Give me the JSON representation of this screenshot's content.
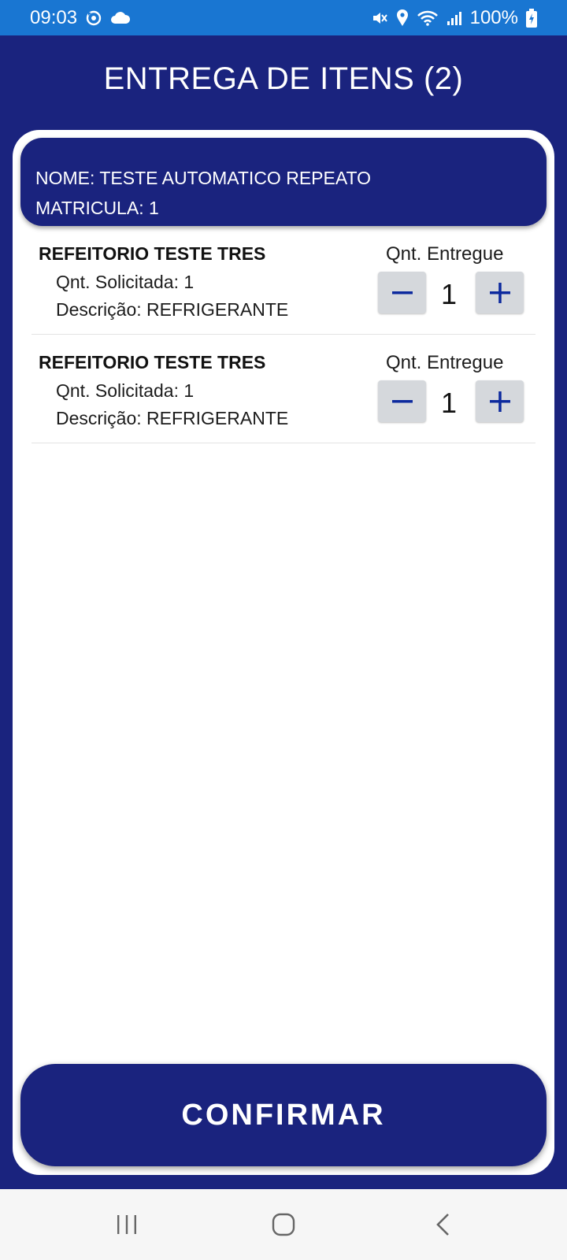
{
  "status_bar": {
    "time": "09:03",
    "battery": "100%",
    "icons_left": [
      "sync-icon",
      "cloud-icon"
    ],
    "icons_right": [
      "mute-icon",
      "location-icon",
      "wifi-icon",
      "signal-icon",
      "battery-icon"
    ]
  },
  "header": {
    "title": "ENTREGA DE ITENS (2)"
  },
  "user": {
    "name_line": "NOME: TESTE AUTOMATICO REPEATO",
    "id_line": "MATRICULA: 1"
  },
  "items": [
    {
      "title": "REFEITORIO TESTE TRES",
      "requested": "Qnt. Solicitada: 1",
      "description": "Descrição: REFRIGERANTE",
      "qty_label": "Qnt. Entregue",
      "qty": "1"
    },
    {
      "title": "REFEITORIO TESTE TRES",
      "requested": "Qnt. Solicitada: 1",
      "description": "Descrição: REFRIGERANTE",
      "qty_label": "Qnt. Entregue",
      "qty": "1"
    }
  ],
  "actions": {
    "confirm_label": "CONFIRMAR"
  },
  "colors": {
    "primary": "#1a237e",
    "status_bar": "#1976d2",
    "stepper_bg": "#d5d8dc",
    "stepper_icon": "#0d2a9e"
  },
  "nav": {
    "icons": [
      "recent-apps-icon",
      "home-icon",
      "back-icon"
    ]
  }
}
